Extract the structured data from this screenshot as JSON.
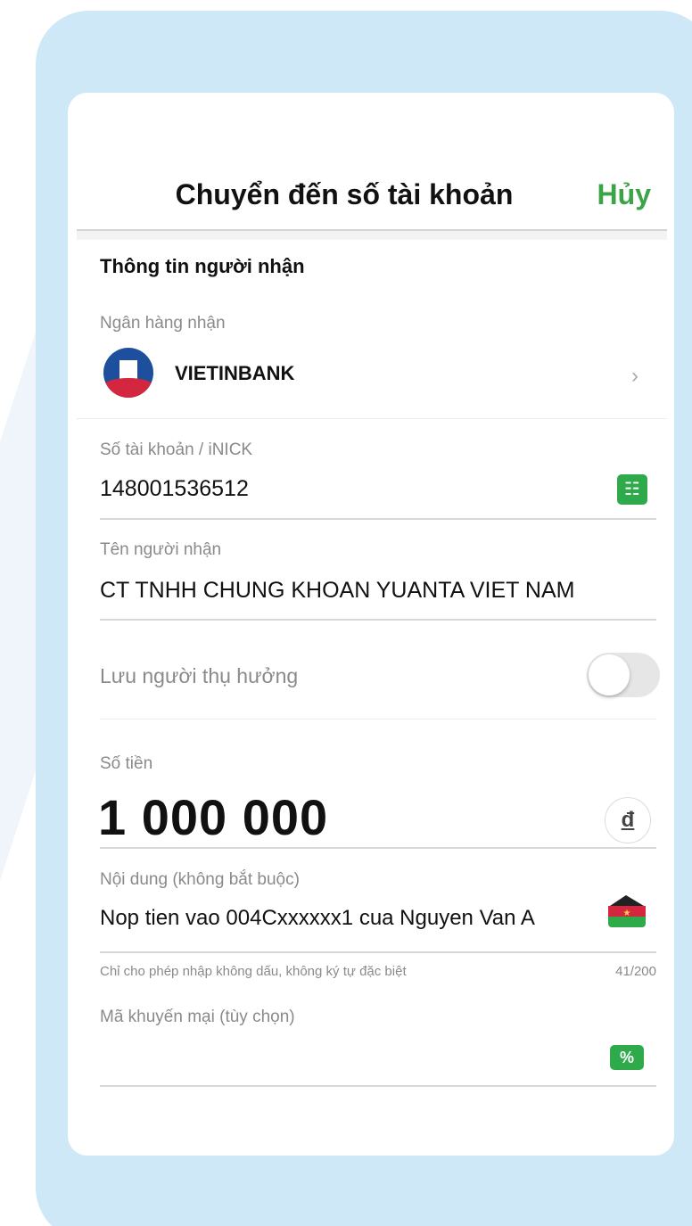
{
  "header": {
    "title": "Chuyển đến số tài khoản",
    "cancel_label": "Hủy"
  },
  "recipient": {
    "section_title": "Thông tin người nhận",
    "bank_label": "Ngân hàng nhận",
    "bank_name": "VIETINBANK",
    "account_label": "Số tài khoản / iNICK",
    "account_value": "148001536512",
    "name_label": "Tên người nhận",
    "name_value": "CT TNHH CHUNG KHOAN YUANTA VIET NAM",
    "save_label": "Lưu người thụ hưởng",
    "save_enabled": false
  },
  "amount": {
    "label": "Số tiền",
    "value": "1 000 000",
    "currency_symbol": "đ"
  },
  "content": {
    "label": "Nội dung (không bắt buộc)",
    "value": "Nop tien vao 004Cxxxxxx1 cua Nguyen Van A",
    "hint": "Chỉ cho phép nhập không dấu, không ký tự đặc biệt",
    "counter": "41/200"
  },
  "promo": {
    "label": "Mã khuyến mại (tùy chọn)",
    "value": ""
  },
  "colors": {
    "accent": "#3aa447",
    "frame": "#cfe8f8",
    "bank_blue": "#1d4f9c",
    "bank_red": "#d5263f"
  },
  "icons": {
    "contacts": "contact-book-icon",
    "promo": "percent-ticket-icon",
    "wallet": "wallet-icon",
    "chevron": "chevron-right-icon"
  }
}
